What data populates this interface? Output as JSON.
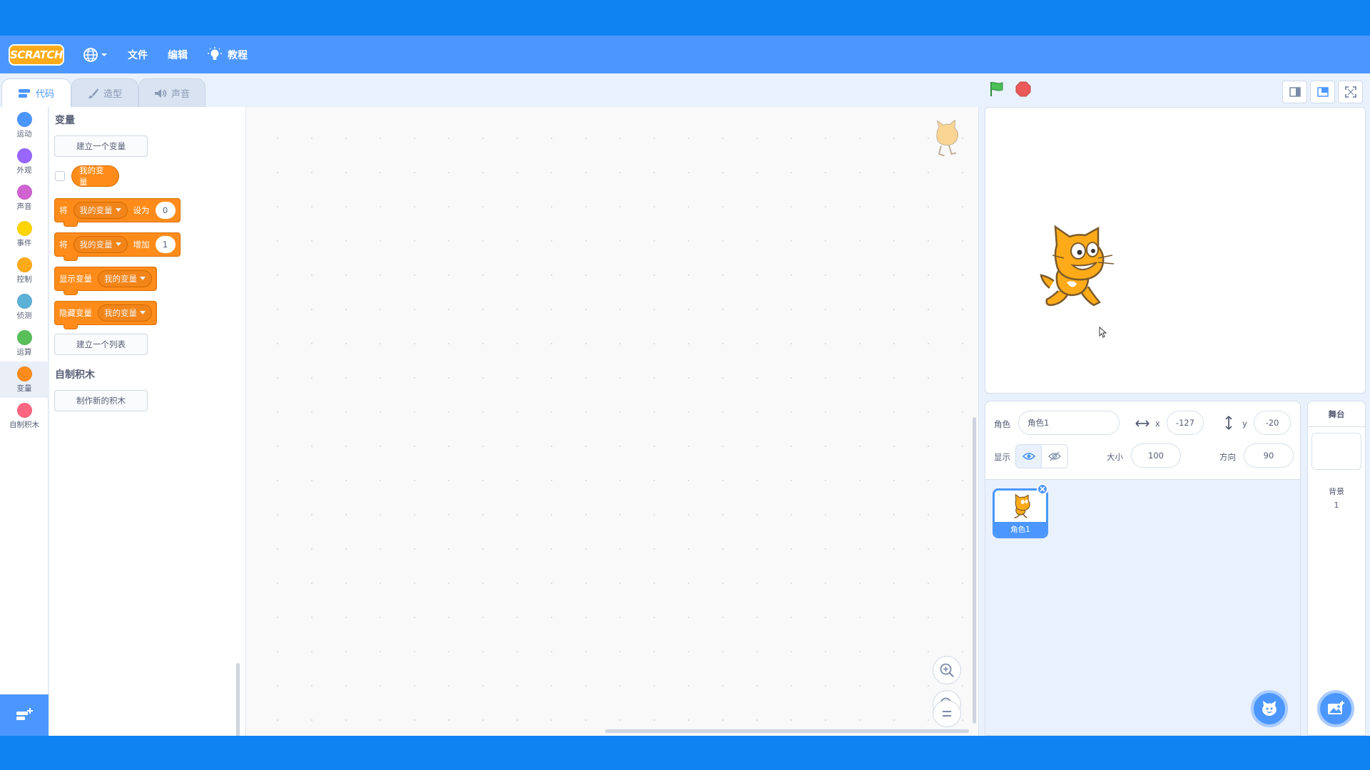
{
  "menubar": {
    "logo": "SCRATCH",
    "file": "文件",
    "edit": "编辑",
    "tutorials": "教程"
  },
  "tabs": [
    {
      "label": "代码"
    },
    {
      "label": "造型"
    },
    {
      "label": "声音"
    }
  ],
  "categories": [
    {
      "label": "运动",
      "color": "#4c97ff"
    },
    {
      "label": "外观",
      "color": "#9966ff"
    },
    {
      "label": "声音",
      "color": "#cf63cf"
    },
    {
      "label": "事件",
      "color": "#ffd500"
    },
    {
      "label": "控制",
      "color": "#ffab19"
    },
    {
      "label": "侦测",
      "color": "#5cb1d6"
    },
    {
      "label": "运算",
      "color": "#59c059"
    },
    {
      "label": "变量",
      "color": "#ff8c1a"
    },
    {
      "label": "自制积木",
      "color": "#ff6680"
    }
  ],
  "palette": {
    "variables_title": "变量",
    "make_variable": "建立一个变量",
    "my_variable": "我的变量",
    "set_block": {
      "prefix": "将",
      "var": "我的变量",
      "op": "设为",
      "value": "0"
    },
    "change_block": {
      "prefix": "将",
      "var": "我的变量",
      "op": "增加",
      "value": "1"
    },
    "show_block": {
      "label": "显示变量",
      "var": "我的变量"
    },
    "hide_block": {
      "label": "隐藏变量",
      "var": "我的变量"
    },
    "make_list": "建立一个列表",
    "my_blocks_title": "自制积木",
    "make_block": "制作新的积木"
  },
  "sprite_info": {
    "sprite_label": "角色",
    "sprite_name": "角色1",
    "x_label": "x",
    "x_value": "-127",
    "y_label": "y",
    "y_value": "-20",
    "show_label": "显示",
    "size_label": "大小",
    "size_value": "100",
    "direction_label": "方向",
    "direction_value": "90"
  },
  "sprites": [
    {
      "name": "角色1"
    }
  ],
  "stage_panel": {
    "title": "舞台",
    "backdrops_label": "背景",
    "backdrops_count": "1"
  },
  "colors": {
    "accent": "#4c97ff",
    "variables": "#ff8c1a",
    "frame": "#0f83f2"
  }
}
